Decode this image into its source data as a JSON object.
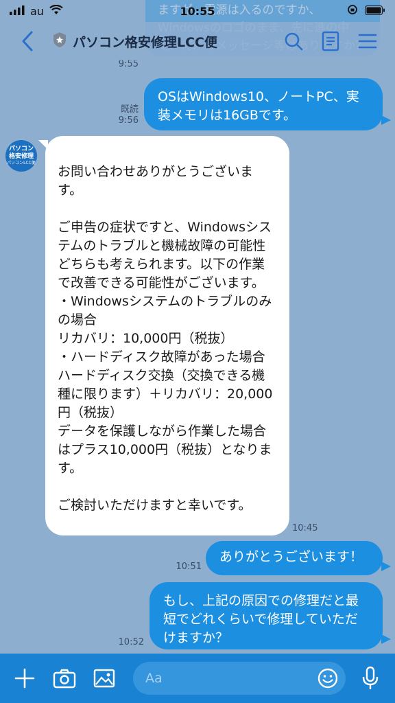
{
  "status": {
    "carrier": "au",
    "time": "10:55"
  },
  "nav": {
    "title": "パソコン格安修理LCC便"
  },
  "messages": [
    {
      "id": "m0",
      "side": "me",
      "text": "ますが、電源は入るのですか、Windowsのロゴのまま、先に進の中で、何かのメッセージ等はありますか？",
      "time": "9:55",
      "read": ""
    },
    {
      "id": "m1",
      "side": "me",
      "text": "OSはWindows10、ノートPC、実装メモリは16GBです。",
      "time": "9:56",
      "read": "既読"
    },
    {
      "id": "m2",
      "side": "them",
      "text": "お問い合わせありがとうございます。\n\nご申告の症状ですと、Windowsシステムのトラブルと機械故障の可能性どちらも考えられます。以下の作業で改善できる可能性がございます。\n・Windowsシステムのトラブルのみの場合\nリカバリ：10,000円（税抜）\n・ハードディスク故障があった場合\nハードディスク交換（交換できる機種に限ります）＋リカバリ：20,000円（税抜）\nデータを保護しながら作業した場合はプラス10,000円（税抜）となります。\n\nご検討いただけますと幸いです。",
      "time": "10:45"
    },
    {
      "id": "m3",
      "side": "me",
      "text": "ありがとうございます！",
      "time": "10:51",
      "read": ""
    },
    {
      "id": "m4",
      "side": "me",
      "text": "もし、上記の原因での修理だと最短でどれくらいで修理していただけますか？",
      "time": "10:52",
      "read": ""
    }
  ],
  "avatar": {
    "line1": "パソコン",
    "line2": "格安修理",
    "line3": "パソコンLCC便"
  },
  "input": {
    "placeholder": "Aa"
  },
  "colors": {
    "background": "#8eaed0",
    "my_bubble": "#1d8fe0",
    "their_bubble": "#ffffff",
    "input_bar": "#1a82d3"
  }
}
